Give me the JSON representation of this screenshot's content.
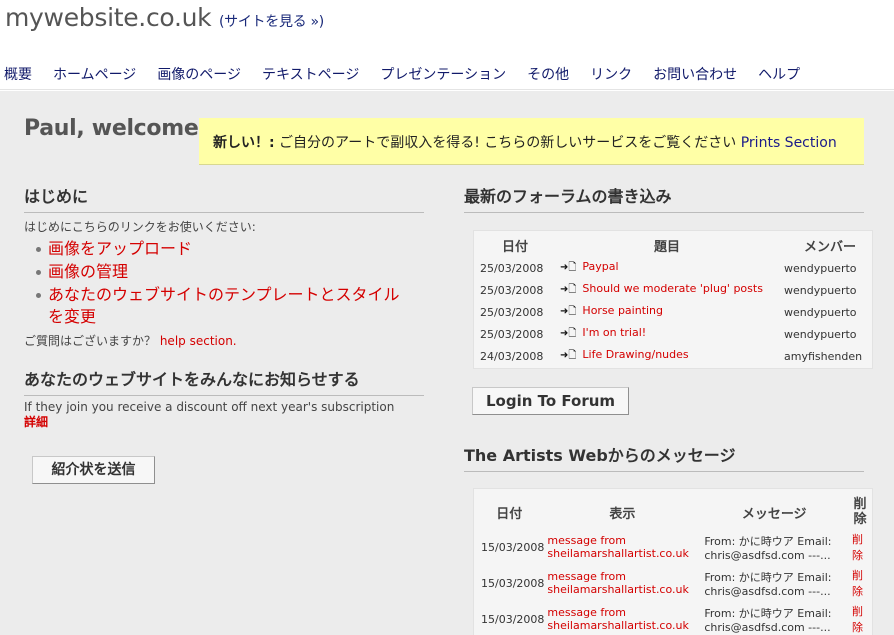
{
  "header": {
    "site_title": "mywebsite.co.uk",
    "view_site_open": "(",
    "view_site_label": "サイトを見る »",
    "view_site_close": ")"
  },
  "nav": {
    "items": [
      {
        "label": "概要"
      },
      {
        "label": "ホームページ"
      },
      {
        "label": "画像のページ"
      },
      {
        "label": "テキストページ"
      },
      {
        "label": "プレゼンテーション"
      },
      {
        "label": "その他"
      },
      {
        "label": "リンク"
      },
      {
        "label": "お問い合わせ"
      },
      {
        "label": "ヘルプ"
      }
    ]
  },
  "welcome": "Paul, welcome!",
  "notice": {
    "prefix": "新しい！:",
    "text": " ご自分のアートで副収入を得る! こちらの新しいサービスをご覧ください ",
    "link": "Prints Section"
  },
  "getting_started": {
    "title": "はじめに",
    "intro": "はじめにこちらのリンクをお使いください:",
    "links": [
      {
        "label": "画像をアップロード"
      },
      {
        "label": "画像の管理"
      },
      {
        "label": "あなたのウェブサイトのテンプレートとスタイルを変更"
      }
    ],
    "question": "ご質問はございますか？ ",
    "help_link": "help section."
  },
  "share": {
    "title": "あなたのウェブサイトをみんなにお知らせする",
    "text": "If they join you receive a discount off next year's subscription",
    "details_link": "詳細",
    "button": "紹介状を送信"
  },
  "forum": {
    "title": "最新のフォーラムの書き込み",
    "headers": {
      "date": "日付",
      "subject": "題目",
      "member": "メンバー"
    },
    "icon": "➜🗋",
    "rows": [
      {
        "date": "25/03/2008",
        "subject": "Paypal",
        "member": "wendypuerto"
      },
      {
        "date": "25/03/2008",
        "subject": "Should we moderate 'plug' posts",
        "member": "wendypuerto"
      },
      {
        "date": "25/03/2008",
        "subject": "Horse painting",
        "member": "wendypuerto"
      },
      {
        "date": "25/03/2008",
        "subject": "I'm on trial!",
        "member": "wendypuerto"
      },
      {
        "date": "24/03/2008",
        "subject": "Life Drawing/nudes",
        "member": "amyfishenden"
      }
    ],
    "login_button": "Login To Forum"
  },
  "messages": {
    "title": "The Artists Webからのメッセージ",
    "headers": {
      "date": "日付",
      "view": "表示",
      "message": "メッセージ",
      "delete": "削除"
    },
    "rows": [
      {
        "date": "15/03/2008",
        "view": "message from sheilamarshallartist.co.uk",
        "message": "From: かに時ウア Email: chris@asdfsd.com ---...",
        "delete": "削除"
      },
      {
        "date": "15/03/2008",
        "view": "message from sheilamarshallartist.co.uk",
        "message": "From: かに時ウア Email: chris@asdfsd.com ---...",
        "delete": "削除"
      },
      {
        "date": "15/03/2008",
        "view": "message from sheilamarshallartist.co.uk",
        "message": "From: かに時ウア Email: chris@asdfsd.com ---...",
        "delete": "削除"
      }
    ]
  }
}
